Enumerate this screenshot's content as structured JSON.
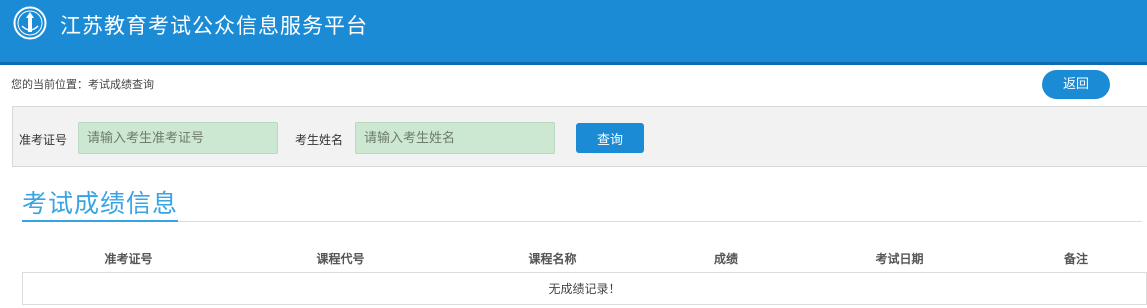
{
  "header": {
    "logo_icon": "emblem-icon",
    "title": "江苏教育考试公众信息服务平台",
    "background_color": "#1c8bd6"
  },
  "breadcrumb": {
    "text": "您的当前位置：考试成绩查询"
  },
  "back_button": {
    "label": "返回"
  },
  "search": {
    "exam_id_label": "准考证号",
    "exam_id_placeholder": "请输入考生准考证号",
    "exam_id_value": "",
    "name_label": "考生姓名",
    "name_placeholder": "请输入考生姓名",
    "name_value": "",
    "query_label": "查询",
    "input_background": "#cde8d2"
  },
  "results": {
    "section_title": "考试成绩信息",
    "columns": [
      "准考证号",
      "课程代号",
      "课程名称",
      "成绩",
      "考试日期",
      "备注"
    ],
    "rows": [],
    "empty_message": "无成绩记录！"
  }
}
